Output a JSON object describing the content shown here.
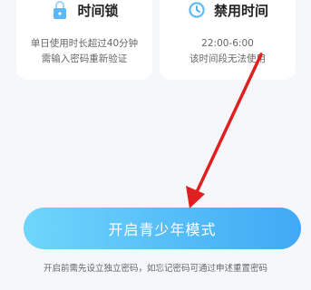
{
  "features": [
    {
      "title": "时间锁",
      "desc_lines": [
        "单日使用时长超过40分钟",
        "需输入密码重新验证"
      ],
      "icon": "lock-icon"
    },
    {
      "title": "禁用时间",
      "desc_lines": [
        "22:00-6:00",
        "该时间段无法使用"
      ],
      "icon": "clock-icon"
    }
  ],
  "primary_button": {
    "label": "开启青少年模式"
  },
  "hint": "开启前需先设立独立密码，如忘记密码可通过申述重置密码",
  "colors": {
    "accent": "#3fa9f5",
    "annotation_arrow": "#e02020"
  }
}
